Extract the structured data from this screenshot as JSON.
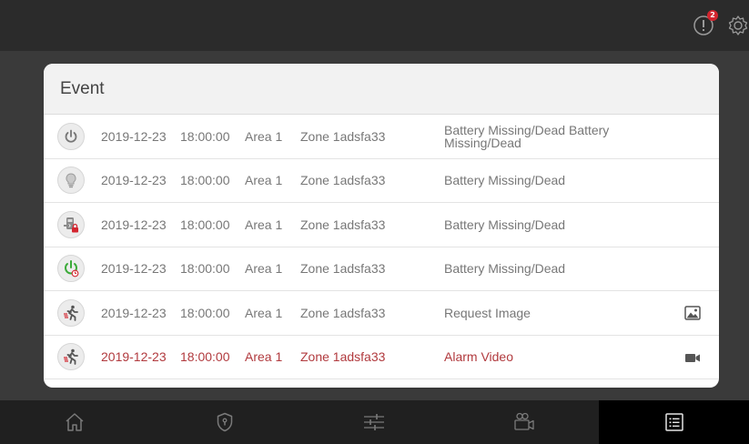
{
  "header": {
    "alert_count": "2"
  },
  "card": {
    "title": "Event"
  },
  "events": [
    {
      "icon": "power-icon",
      "date": "2019-12-23",
      "time": "18:00:00",
      "area": "Area 1",
      "zone": "Zone 1adsfa33",
      "description": "Battery Missing/Dead Battery Missing/Dead",
      "action_icon": ""
    },
    {
      "icon": "light-bulb-icon",
      "date": "2019-12-23",
      "time": "18:00:00",
      "area": "Area 1",
      "zone": "Zone 1adsfa33",
      "description": "Battery Missing/Dead",
      "action_icon": ""
    },
    {
      "icon": "door-lock-icon",
      "date": "2019-12-23",
      "time": "18:00:00",
      "area": "Area 1",
      "zone": "Zone 1adsfa33",
      "description": "Battery Missing/Dead",
      "action_icon": ""
    },
    {
      "icon": "power-timer-icon",
      "date": "2019-12-23",
      "time": "18:00:00",
      "area": "Area 1",
      "zone": "Zone 1adsfa33",
      "description": "Battery Missing/Dead",
      "action_icon": ""
    },
    {
      "icon": "motion-sensor-icon",
      "date": "2019-12-23",
      "time": "18:00:00",
      "area": "Area 1",
      "zone": "Zone 1adsfa33",
      "description": "Request Image",
      "action_icon": "image-icon"
    },
    {
      "icon": "motion-sensor-icon",
      "date": "2019-12-23",
      "time": "18:00:00",
      "area": "Area 1",
      "zone": "Zone 1adsfa33",
      "description": "Alarm Video",
      "action_icon": "video-camera-icon"
    }
  ],
  "nav": [
    "home-icon",
    "security-shield-icon",
    "settings-sliders-icon",
    "camera-icon",
    "event-list-icon"
  ],
  "colors": {
    "alarm_text": "#b13a3e",
    "badge": "#d3252f",
    "power_green": "#3cab3a",
    "lock_red": "#d3252f"
  }
}
